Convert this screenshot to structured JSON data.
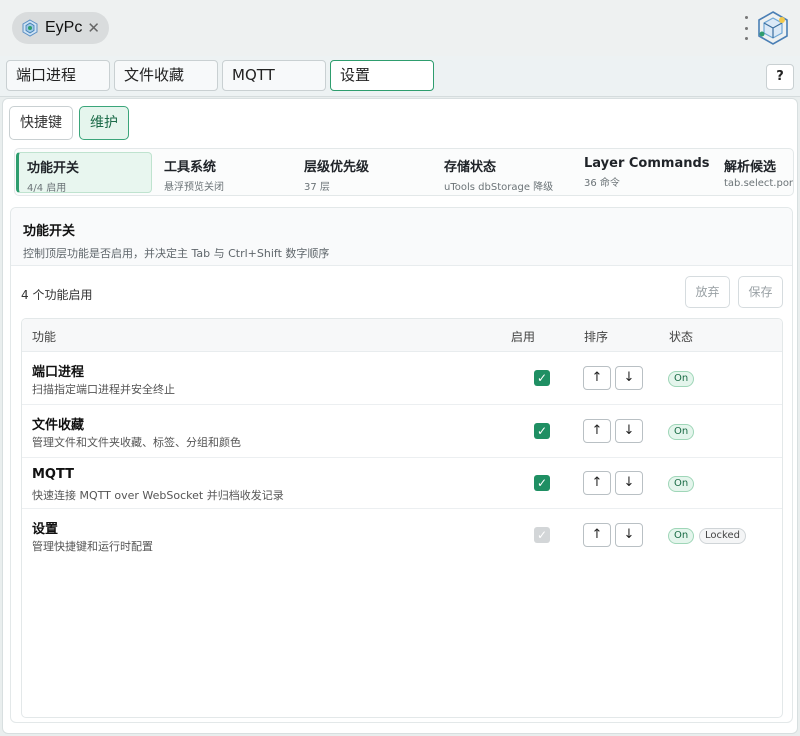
{
  "window": {
    "app_name": "EyPc",
    "close_glyph": "✕",
    "app_icon": "app-logo-icon",
    "menu_icon": "kebab-menu-icon",
    "corner_icon": "brand-logo-icon"
  },
  "top_tabs": [
    {
      "label": "端口进程"
    },
    {
      "label": "文件收藏"
    },
    {
      "label": "MQTT"
    },
    {
      "label": "设置",
      "active": true
    }
  ],
  "help": {
    "label": "?"
  },
  "sub_tabs": [
    {
      "label": "快捷键"
    },
    {
      "label": "维护",
      "active": true
    }
  ],
  "sections": [
    {
      "title": "功能开关",
      "sub": "4/4 启用",
      "active": true
    },
    {
      "title": "工具系统",
      "sub": "悬浮预览关闭"
    },
    {
      "title": "层级优先级",
      "sub": "37 层"
    },
    {
      "title": "存储状态",
      "sub": "uTools dbStorage 降级"
    },
    {
      "title": "Layer Commands",
      "sub": "36 命令"
    },
    {
      "title": "解析候选",
      "sub": "tab.select.por"
    }
  ],
  "card": {
    "title": "功能开关",
    "description": "控制顶层功能是否启用，并决定主 Tab 与 Ctrl+Shift 数字顺序",
    "count_label": "4 个功能启用",
    "discard_label": "放弃",
    "save_label": "保存"
  },
  "table": {
    "headers": {
      "feature": "功能",
      "enabled": "启用",
      "order": "排序",
      "status": "状态"
    },
    "up_glyph": "↑",
    "down_glyph": "↓",
    "check_glyph": "✓",
    "rows": [
      {
        "name": "端口进程",
        "desc": "扫描指定端口进程并安全终止",
        "enabled": true,
        "status": "On"
      },
      {
        "name": "文件收藏",
        "desc": "管理文件和文件夹收藏、标签、分组和颜色",
        "enabled": true,
        "status": "On"
      },
      {
        "name": "MQTT",
        "desc": "快速连接 MQTT over WebSocket 并归档收发记录",
        "enabled": true,
        "status": "On"
      },
      {
        "name": "设置",
        "desc": "管理快捷键和运行时配置",
        "enabled": true,
        "disabled": true,
        "status": "On",
        "extra_badge": "Locked"
      }
    ]
  },
  "colors": {
    "accent": "#2e9d6e",
    "check": "#1f8f63",
    "active_bg": "#e5f5ed"
  }
}
